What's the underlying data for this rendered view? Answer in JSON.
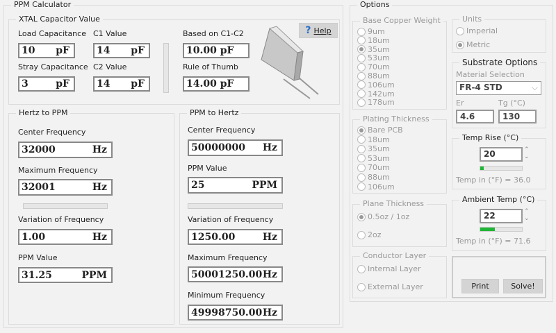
{
  "calc": {
    "title": "PPM Calculator",
    "xtal": {
      "title": "XTAL Capacitor Value",
      "load_label": "Load Capacitance",
      "load_value": "10",
      "stray_label": "Stray Capacitance",
      "stray_value": "3",
      "c1_label": "C1 Value",
      "c1_value": "14",
      "c2_label": "C2 Value",
      "c2_value": "14",
      "unit": "pF",
      "based_label": "Based on C1-C2",
      "based_value": "10.00 pF",
      "rule_label": "Rule of Thumb",
      "rule_value": "14.00 pF",
      "help_icon": "?",
      "help_label": "Help"
    },
    "hz_to_ppm": {
      "title": "Hertz to PPM",
      "center_label": "Center Frequency",
      "center_value": "32000",
      "max_label": "Maximum Frequency",
      "max_value": "32001",
      "var_label": "Variation of Frequency",
      "var_value": "1.00",
      "ppm_label": "PPM Value",
      "ppm_value": "31.25",
      "hz": "Hz",
      "ppm": "PPM"
    },
    "ppm_to_hz": {
      "title": "PPM to Hertz",
      "center_label": "Center Frequency",
      "center_value": "50000000",
      "ppm_label": "PPM Value",
      "ppm_value": "25",
      "var_label": "Variation of Frequency",
      "var_value": "1250.00",
      "max_label": "Maximum Frequency",
      "max_value": "50001250.00",
      "min_label": "Minimum Frequency",
      "min_value": "49998750.00",
      "hz": "Hz",
      "ppm": "PPM"
    }
  },
  "options": {
    "title": "Options",
    "copper": {
      "title": "Base Copper Weight",
      "items": [
        "9um",
        "18um",
        "35um",
        "53um",
        "70um",
        "88um",
        "106um",
        "142um",
        "178um"
      ],
      "selected": 2
    },
    "plating": {
      "title": "Plating Thickness",
      "items": [
        "Bare PCB",
        "18um",
        "35um",
        "53um",
        "70um",
        "88um",
        "106um"
      ],
      "selected": 0
    },
    "plane": {
      "title": "Plane Thickness",
      "items": [
        "0.5oz / 1oz",
        "2oz"
      ],
      "selected": 0
    },
    "conductor": {
      "title": "Conductor Layer",
      "items": [
        "Internal Layer",
        "External Layer"
      ],
      "selected": -1
    },
    "units": {
      "title": "Units",
      "items": [
        "Imperial",
        "Metric"
      ],
      "selected": 1
    },
    "substrate": {
      "title": "Substrate Options",
      "material_label": "Material Selection",
      "material_value": "FR-4 STD",
      "er_label": "Er",
      "er_value": "4.6",
      "tg_label": "Tg (°C)",
      "tg_value": "130"
    },
    "temp_rise": {
      "title": "Temp Rise (°C)",
      "value": "20",
      "bar_fraction": 0.08,
      "readout": "Temp in (°F) = 36.0"
    },
    "ambient": {
      "title": "Ambient Temp (°C)",
      "value": "22",
      "bar_fraction": 0.35,
      "readout": "Temp in (°F) = 71.6"
    },
    "print_label": "Print",
    "solve_label": "Solve!"
  },
  "colors": {
    "bar_fill": "#1fb536"
  }
}
